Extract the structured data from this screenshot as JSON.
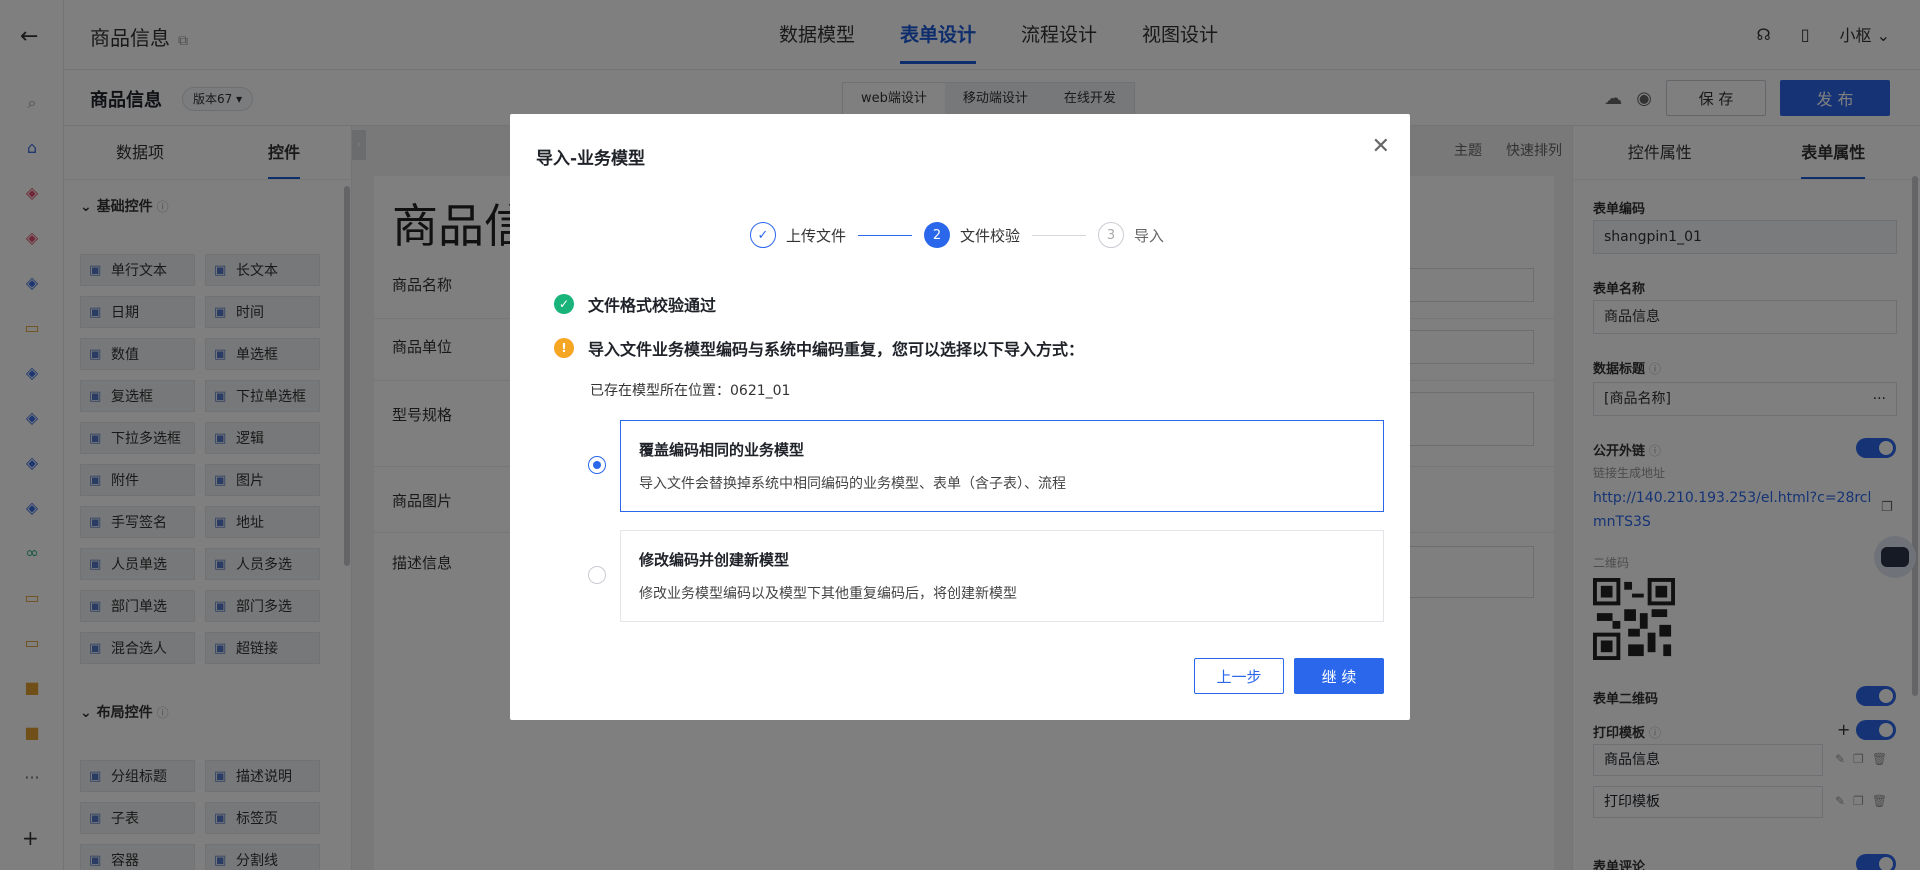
{
  "header": {
    "app_title": "商品信息",
    "tabs": [
      {
        "label": "数据模型",
        "active": false
      },
      {
        "label": "表单设计",
        "active": true
      },
      {
        "label": "流程设计",
        "active": false
      },
      {
        "label": "视图设计",
        "active": false
      }
    ],
    "user": "小枢 ⌄"
  },
  "subheader": {
    "form_name": "商品信息",
    "version": "版本67 ▾",
    "segments": [
      "web端设计",
      "移动端设计",
      "在线开发"
    ],
    "save_label": "保 存",
    "publish_label": "发 布"
  },
  "left_panel": {
    "tabs": [
      "数据项",
      "控件"
    ],
    "basic_group": "基础控件",
    "layout_group": "布局控件",
    "basic_controls": [
      {
        "label": "单行文本",
        "icon": "text-line-icon"
      },
      {
        "label": "长文本",
        "icon": "text-long-icon"
      },
      {
        "label": "日期",
        "icon": "calendar-icon"
      },
      {
        "label": "时间",
        "icon": "clock-icon"
      },
      {
        "label": "数值",
        "icon": "number-icon"
      },
      {
        "label": "单选框",
        "icon": "radio-icon"
      },
      {
        "label": "复选框",
        "icon": "checkbox-icon"
      },
      {
        "label": "下拉单选框",
        "icon": "dropdown-icon"
      },
      {
        "label": "下拉多选框",
        "icon": "dropdown-multi-icon"
      },
      {
        "label": "逻辑",
        "icon": "toggle-icon"
      },
      {
        "label": "附件",
        "icon": "paperclip-icon"
      },
      {
        "label": "图片",
        "icon": "image-icon"
      },
      {
        "label": "手写签名",
        "icon": "pen-icon"
      },
      {
        "label": "地址",
        "icon": "location-pin-icon"
      },
      {
        "label": "人员单选",
        "icon": "user-icon"
      },
      {
        "label": "人员多选",
        "icon": "users-icon"
      },
      {
        "label": "部门单选",
        "icon": "department-icon"
      },
      {
        "label": "部门多选",
        "icon": "department-multi-icon"
      },
      {
        "label": "混合选人",
        "icon": "user-mixed-icon"
      },
      {
        "label": "超链接",
        "icon": "link-icon"
      }
    ],
    "layout_controls": [
      {
        "label": "分组标题",
        "icon": "title-icon"
      },
      {
        "label": "描述说明",
        "icon": "question-icon"
      },
      {
        "label": "子表",
        "icon": "table-icon"
      },
      {
        "label": "标签页",
        "icon": "tabs-icon"
      },
      {
        "label": "容器",
        "icon": "container-icon"
      },
      {
        "label": "分割线",
        "icon": "divider-icon"
      }
    ]
  },
  "canvas": {
    "toolbar": [
      "主题",
      "快速排列"
    ],
    "form_title": "商品信",
    "fields": [
      "商品名称",
      "商品单位",
      "型号规格",
      "商品图片",
      "描述信息"
    ]
  },
  "right_panel": {
    "tabs": [
      "控件属性",
      "表单属性"
    ],
    "form_code_label": "表单编码",
    "form_code": "shangpin1_01",
    "form_name_label": "表单名称",
    "form_name": "商品信息",
    "data_title_label": "数据标题",
    "data_title": "[商品名称]",
    "public_link_label": "公开外链",
    "link_hint": "链接生成地址",
    "link_url": "http://140.210.193.253/el.html?c=28rclmnTS3S",
    "qr_label": "二维码",
    "form_qr_label": "表单二维码",
    "print_tpl_label": "打印模板",
    "print_templates": [
      "商品信息",
      "打印模板"
    ],
    "form_comment_label": "表单评论"
  },
  "modal": {
    "title": "导入-业务模型",
    "steps": [
      {
        "num": "✓",
        "label": "上传文件",
        "state": "done"
      },
      {
        "num": "2",
        "label": "文件校验",
        "state": "current"
      },
      {
        "num": "3",
        "label": "导入",
        "state": "todo"
      }
    ],
    "success_msg": "文件格式校验通过",
    "warn_msg": "导入文件业务模型编码与系统中编码重复，您可以选择以下导入方式：",
    "location_text": "已存在模型所在位置：0621_01",
    "options": [
      {
        "title": "覆盖编码相同的业务模型",
        "desc": "导入文件会替换掉系统中相同编码的业务模型、表单（含子表）、流程",
        "selected": true
      },
      {
        "title": "修改编码并创建新模型",
        "desc": "修改业务模型编码以及模型下其他重复编码后，将创建新模型",
        "selected": false
      }
    ],
    "prev_label": "上一步",
    "next_label": "继 续"
  },
  "colors": {
    "primary": "#2a67ea",
    "success": "#19b47a",
    "warning": "#f5a623"
  }
}
